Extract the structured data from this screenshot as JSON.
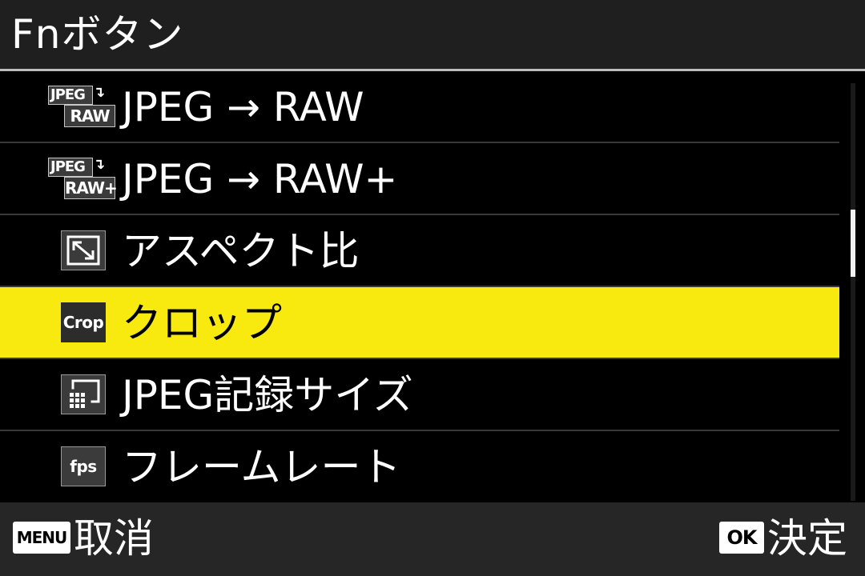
{
  "header": {
    "title": "Fnボタン"
  },
  "menu": {
    "items": [
      {
        "icon": "jpeg-to-raw-icon",
        "icon_top": "JPEG",
        "icon_arrow": "↴",
        "icon_bottom": "RAW",
        "label": "JPEG → RAW",
        "selected": false
      },
      {
        "icon": "jpeg-to-raw-plus-icon",
        "icon_top": "JPEG",
        "icon_arrow": "↴",
        "icon_bottom": "RAW+",
        "label": "JPEG → RAW+",
        "selected": false
      },
      {
        "icon": "aspect-ratio-icon",
        "label": "アスペクト比",
        "selected": false
      },
      {
        "icon": "crop-icon",
        "icon_text": "Crop",
        "label": "クロップ",
        "selected": true
      },
      {
        "icon": "jpeg-size-icon",
        "label": "JPEG記録サイズ",
        "selected": false
      },
      {
        "icon": "frame-rate-icon",
        "icon_text": "fps",
        "label": "フレームレート",
        "selected": false
      }
    ]
  },
  "scrollbar": {
    "position_fraction": 0.36
  },
  "footer": {
    "cancel_key": "MENU",
    "cancel_label": "取消",
    "confirm_key": "OK",
    "confirm_label": "決定"
  },
  "colors": {
    "highlight": "#f8ea0f",
    "background": "#000000",
    "header_background": "#1f1f1f",
    "footer_background": "#262626"
  }
}
